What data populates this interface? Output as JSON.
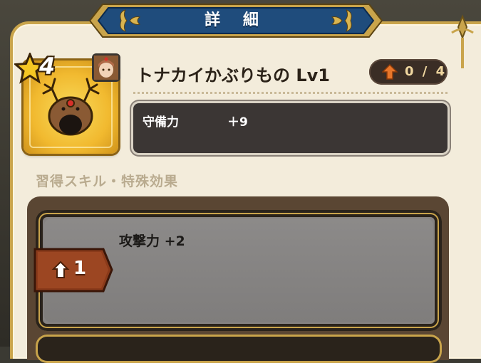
{
  "header": {
    "title": "詳 細"
  },
  "item": {
    "stars": "4",
    "name": "トナカイかぶりもの Lv1",
    "upgrade_count": "0 / 4"
  },
  "stats": [
    {
      "label": "守備力",
      "value": "＋9"
    }
  ],
  "skills": {
    "heading": "習得スキル・特殊効果",
    "entries": [
      {
        "level": "1",
        "effect": "攻撃力 +2"
      }
    ]
  },
  "colors": {
    "banner_blue": "#1f4c7c",
    "gold": "#c9a44b",
    "upgrade_arrow": "#e8762a"
  }
}
